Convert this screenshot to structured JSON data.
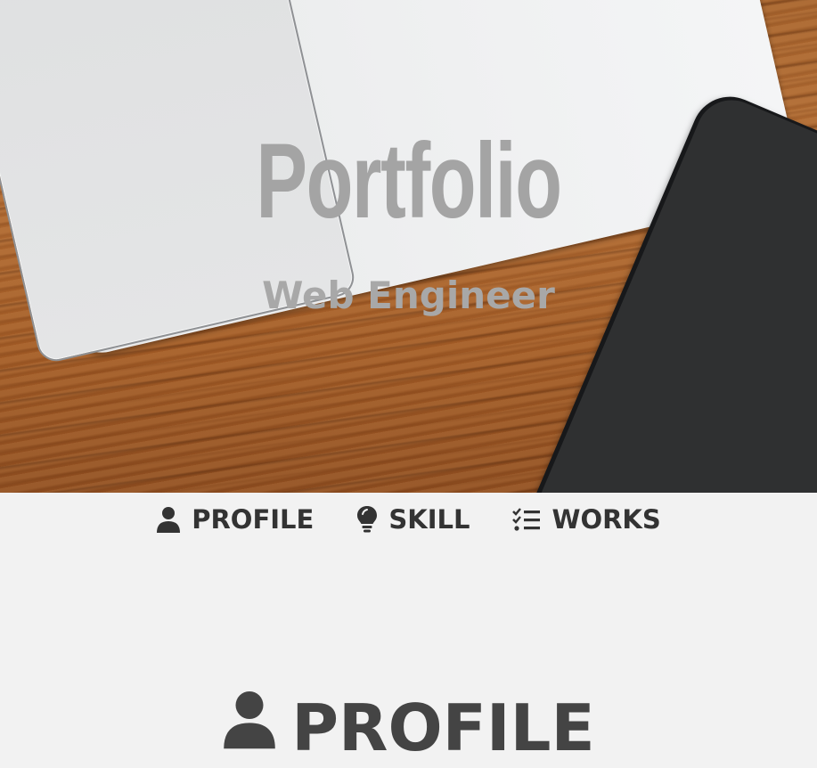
{
  "hero": {
    "title": "Portfolio",
    "subtitle": "Web Engineer"
  },
  "nav": {
    "items": [
      {
        "label": "PROFILE",
        "icon": "user-icon"
      },
      {
        "label": "SKILL",
        "icon": "lightbulb-icon"
      },
      {
        "label": "WORKS",
        "icon": "tasks-list-icon"
      }
    ]
  },
  "profile_section": {
    "heading": "PROFILE",
    "icon": "user-icon"
  },
  "colors": {
    "page_background": "#f2f2f2",
    "nav_text": "#333333",
    "hero_text": "#a4a4a4",
    "heading_text": "#444444"
  }
}
